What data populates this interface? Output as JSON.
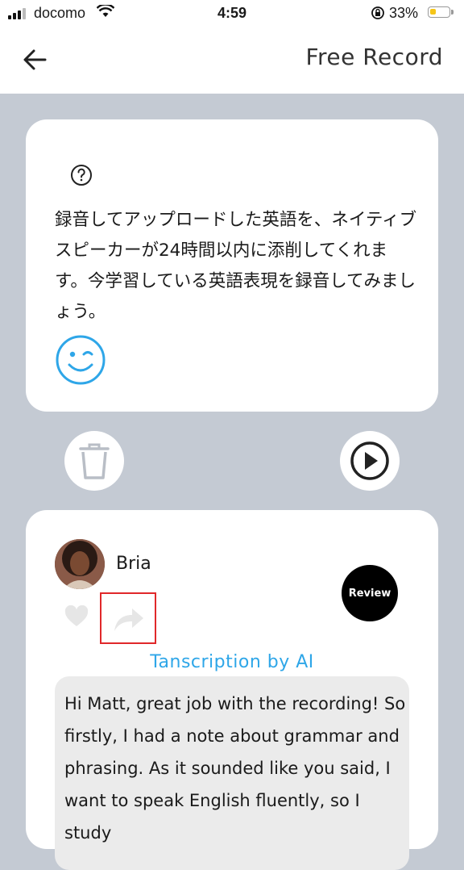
{
  "status_bar": {
    "carrier": "docomo",
    "time": "4:59",
    "battery_percent": "33%",
    "battery_level": 0.33,
    "icons": [
      "signal-icon",
      "wifi-icon",
      "orientation-lock-icon",
      "battery-icon"
    ]
  },
  "nav": {
    "back_icon": "back-arrow-icon",
    "title": "Free Record"
  },
  "info_card": {
    "help_icon": "question-circle-icon",
    "text": "録音してアップロードした英語を、ネイティブスピーカーが24時間以内に添削してくれます。今学習している英語表現を録音してみましょう。",
    "mascot_icon": "wink-face-icon"
  },
  "controls": {
    "trash_icon": "trash-icon",
    "play_icon": "play-icon"
  },
  "feedback": {
    "reviewer_name": "Bria",
    "review_label": "Review",
    "transcription_label": "Tanscription by AI",
    "transcript": "Hi Matt, great job with the recording! So firstly, I had a note about grammar and phrasing. As it sounded like you said, I want to speak English fluently, so I study",
    "icons": [
      "heart-icon",
      "share-icon"
    ]
  },
  "colors": {
    "background": "#c4cad3",
    "accent_blue": "#2ea6e8",
    "highlight_red": "#e0282a"
  }
}
